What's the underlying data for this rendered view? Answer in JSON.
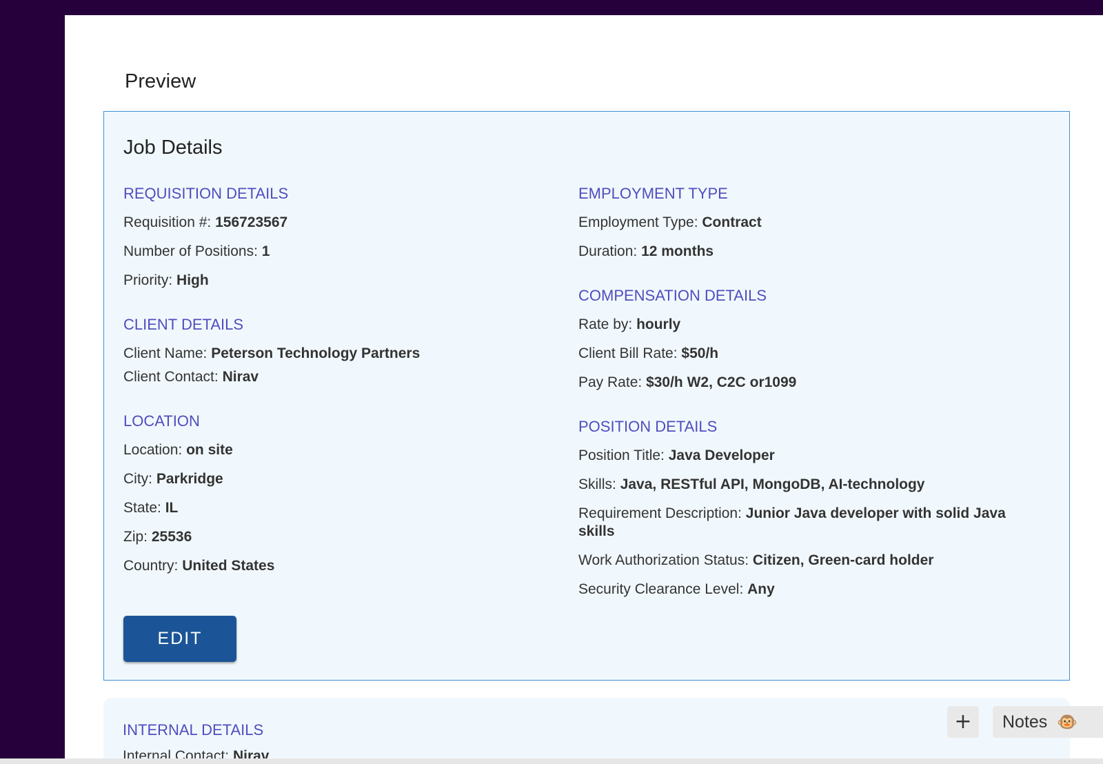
{
  "page_title": "Preview",
  "card_title": "Job Details",
  "left_sections": [
    {
      "title": "REQUISITION DETAILS",
      "rows": [
        {
          "label": "Requisition #:",
          "value": "156723567"
        },
        {
          "label": "Number of Positions:",
          "value": "1"
        },
        {
          "label": "Priority:",
          "value": "High"
        }
      ]
    },
    {
      "title": "CLIENT DETAILS",
      "rows": [
        {
          "label": "Client Name:",
          "value": "Peterson Technology Partners"
        },
        {
          "label": "Client Contact:",
          "value": "Nirav"
        }
      ]
    },
    {
      "title": "LOCATION",
      "rows": [
        {
          "label": "Location:",
          "value": "on site"
        },
        {
          "label": "City:",
          "value": "Parkridge"
        },
        {
          "label": "State:",
          "value": "IL"
        },
        {
          "label": "Zip:",
          "value": "25536"
        },
        {
          "label": "Country:",
          "value": "United States"
        }
      ]
    }
  ],
  "right_sections": [
    {
      "title": "EMPLOYMENT TYPE",
      "rows": [
        {
          "label": "Employment Type:",
          "value": "Contract"
        },
        {
          "label": "Duration:",
          "value": "12 months"
        }
      ]
    },
    {
      "title": "COMPENSATION DETAILS",
      "rows": [
        {
          "label": "Rate by:",
          "value": "hourly"
        },
        {
          "label": "Client Bill Rate:",
          "value": "$50/h"
        },
        {
          "label": "Pay Rate:",
          "value": "$30/h W2, C2C or1099"
        }
      ]
    },
    {
      "title": "POSITION DETAILS",
      "rows": [
        {
          "label": "Position Title:",
          "value": "Java Developer"
        },
        {
          "label": "Skills:",
          "value": "Java, RESTful API, MongoDB, AI-technology"
        },
        {
          "label": "Requirement Description:",
          "value": "Junior Java developer with solid Java skills"
        },
        {
          "label": "Work Authorization Status:",
          "value": "Citizen, Green-card holder"
        },
        {
          "label": "Security Clearance Level:",
          "value": "Any"
        }
      ]
    }
  ],
  "edit_label": "EDIT",
  "internal": {
    "title": "INTERNAL DETAILS",
    "contact_label": "Internal Contact:",
    "contact_value": "Nirav"
  },
  "plus_label": "+",
  "notes_label": "Notes",
  "notes_icon": "🐵"
}
